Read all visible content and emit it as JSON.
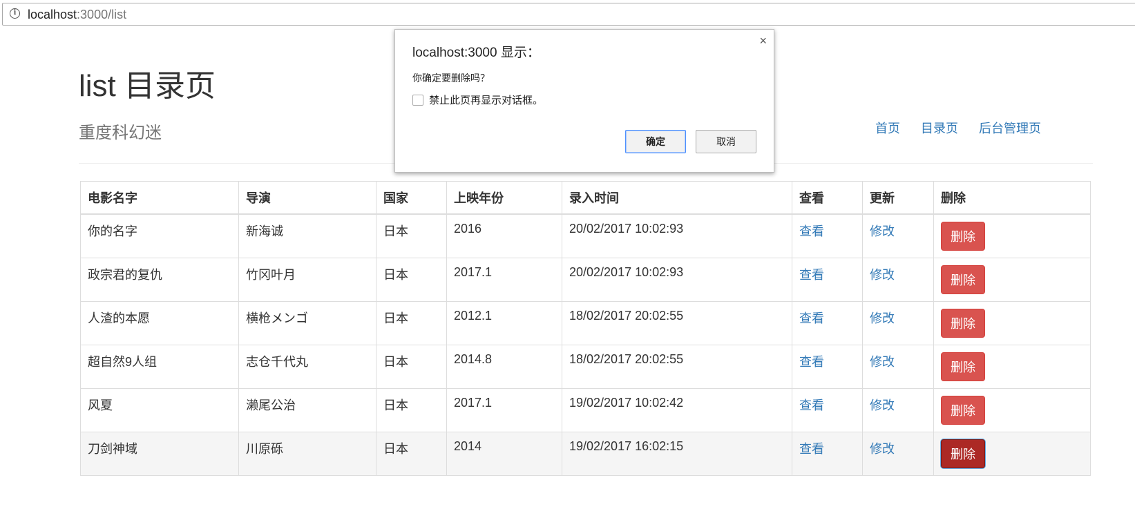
{
  "browser": {
    "url_host": "localhost",
    "url_path": ":3000/list"
  },
  "page": {
    "title": "list 目录页",
    "subtitle": "重度科幻迷",
    "nav": [
      "首页",
      "目录页",
      "后台管理页"
    ]
  },
  "table": {
    "headers": [
      "电影名字",
      "导演",
      "国家",
      "上映年份",
      "录入时间",
      "查看",
      "更新",
      "删除"
    ],
    "view_label": "查看",
    "edit_label": "修改",
    "delete_label": "删除",
    "rows": [
      {
        "name": "你的名字",
        "director": "新海诚",
        "country": "日本",
        "year": "2016",
        "time": "20/02/2017 10:02:93"
      },
      {
        "name": "政宗君的复仇",
        "director": "竹冈叶月",
        "country": "日本",
        "year": "2017.1",
        "time": "20/02/2017 10:02:93"
      },
      {
        "name": "人渣的本愿",
        "director": "横枪メンゴ",
        "country": "日本",
        "year": "2012.1",
        "time": "18/02/2017 20:02:55"
      },
      {
        "name": "超自然9人组",
        "director": "志仓千代丸",
        "country": "日本",
        "year": "2014.8",
        "time": "18/02/2017 20:02:55"
      },
      {
        "name": "风夏",
        "director": "濑尾公治",
        "country": "日本",
        "year": "2017.1",
        "time": "19/02/2017 10:02:42"
      },
      {
        "name": "刀剑神域",
        "director": "川原砾",
        "country": "日本",
        "year": "2014",
        "time": "19/02/2017 16:02:15"
      }
    ]
  },
  "dialog": {
    "title": "localhost:3000 显示：",
    "message": "你确定要删除吗？",
    "checkbox_label": "禁止此页再显示对话框。",
    "ok_label": "确定",
    "cancel_label": "取消",
    "close_glyph": "×"
  },
  "colors": {
    "link": "#337ab7",
    "danger": "#d9534f",
    "danger_active": "#ac2925"
  }
}
